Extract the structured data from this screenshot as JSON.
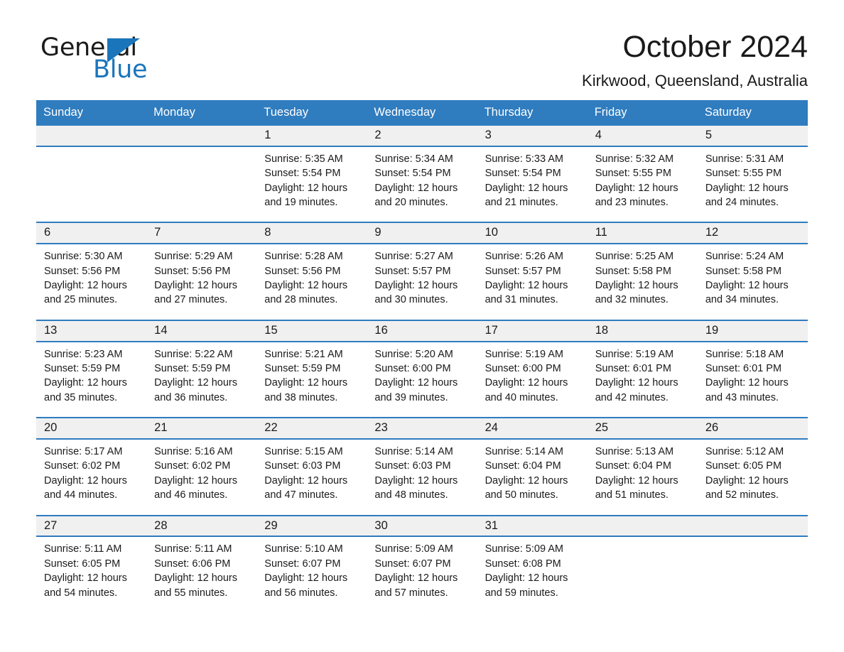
{
  "brand": {
    "name_part1": "General",
    "name_part2": "Blue",
    "logo_icon": "triangle-flag-icon",
    "accent_color": "#1b75bb"
  },
  "header": {
    "month_title": "October 2024",
    "location": "Kirkwood, Queensland, Australia"
  },
  "calendar": {
    "header_bg_color": "#2f7cbf",
    "daynum_bg_color": "#f0f0f0",
    "weekday_headers": [
      "Sunday",
      "Monday",
      "Tuesday",
      "Wednesday",
      "Thursday",
      "Friday",
      "Saturday"
    ],
    "weeks": [
      [
        {
          "day": "",
          "lines": [
            "",
            "",
            "",
            ""
          ]
        },
        {
          "day": "",
          "lines": [
            "",
            "",
            "",
            ""
          ]
        },
        {
          "day": "1",
          "lines": [
            "Sunrise: 5:35 AM",
            "Sunset: 5:54 PM",
            "Daylight: 12 hours",
            "and 19 minutes."
          ]
        },
        {
          "day": "2",
          "lines": [
            "Sunrise: 5:34 AM",
            "Sunset: 5:54 PM",
            "Daylight: 12 hours",
            "and 20 minutes."
          ]
        },
        {
          "day": "3",
          "lines": [
            "Sunrise: 5:33 AM",
            "Sunset: 5:54 PM",
            "Daylight: 12 hours",
            "and 21 minutes."
          ]
        },
        {
          "day": "4",
          "lines": [
            "Sunrise: 5:32 AM",
            "Sunset: 5:55 PM",
            "Daylight: 12 hours",
            "and 23 minutes."
          ]
        },
        {
          "day": "5",
          "lines": [
            "Sunrise: 5:31 AM",
            "Sunset: 5:55 PM",
            "Daylight: 12 hours",
            "and 24 minutes."
          ]
        }
      ],
      [
        {
          "day": "6",
          "lines": [
            "Sunrise: 5:30 AM",
            "Sunset: 5:56 PM",
            "Daylight: 12 hours",
            "and 25 minutes."
          ]
        },
        {
          "day": "7",
          "lines": [
            "Sunrise: 5:29 AM",
            "Sunset: 5:56 PM",
            "Daylight: 12 hours",
            "and 27 minutes."
          ]
        },
        {
          "day": "8",
          "lines": [
            "Sunrise: 5:28 AM",
            "Sunset: 5:56 PM",
            "Daylight: 12 hours",
            "and 28 minutes."
          ]
        },
        {
          "day": "9",
          "lines": [
            "Sunrise: 5:27 AM",
            "Sunset: 5:57 PM",
            "Daylight: 12 hours",
            "and 30 minutes."
          ]
        },
        {
          "day": "10",
          "lines": [
            "Sunrise: 5:26 AM",
            "Sunset: 5:57 PM",
            "Daylight: 12 hours",
            "and 31 minutes."
          ]
        },
        {
          "day": "11",
          "lines": [
            "Sunrise: 5:25 AM",
            "Sunset: 5:58 PM",
            "Daylight: 12 hours",
            "and 32 minutes."
          ]
        },
        {
          "day": "12",
          "lines": [
            "Sunrise: 5:24 AM",
            "Sunset: 5:58 PM",
            "Daylight: 12 hours",
            "and 34 minutes."
          ]
        }
      ],
      [
        {
          "day": "13",
          "lines": [
            "Sunrise: 5:23 AM",
            "Sunset: 5:59 PM",
            "Daylight: 12 hours",
            "and 35 minutes."
          ]
        },
        {
          "day": "14",
          "lines": [
            "Sunrise: 5:22 AM",
            "Sunset: 5:59 PM",
            "Daylight: 12 hours",
            "and 36 minutes."
          ]
        },
        {
          "day": "15",
          "lines": [
            "Sunrise: 5:21 AM",
            "Sunset: 5:59 PM",
            "Daylight: 12 hours",
            "and 38 minutes."
          ]
        },
        {
          "day": "16",
          "lines": [
            "Sunrise: 5:20 AM",
            "Sunset: 6:00 PM",
            "Daylight: 12 hours",
            "and 39 minutes."
          ]
        },
        {
          "day": "17",
          "lines": [
            "Sunrise: 5:19 AM",
            "Sunset: 6:00 PM",
            "Daylight: 12 hours",
            "and 40 minutes."
          ]
        },
        {
          "day": "18",
          "lines": [
            "Sunrise: 5:19 AM",
            "Sunset: 6:01 PM",
            "Daylight: 12 hours",
            "and 42 minutes."
          ]
        },
        {
          "day": "19",
          "lines": [
            "Sunrise: 5:18 AM",
            "Sunset: 6:01 PM",
            "Daylight: 12 hours",
            "and 43 minutes."
          ]
        }
      ],
      [
        {
          "day": "20",
          "lines": [
            "Sunrise: 5:17 AM",
            "Sunset: 6:02 PM",
            "Daylight: 12 hours",
            "and 44 minutes."
          ]
        },
        {
          "day": "21",
          "lines": [
            "Sunrise: 5:16 AM",
            "Sunset: 6:02 PM",
            "Daylight: 12 hours",
            "and 46 minutes."
          ]
        },
        {
          "day": "22",
          "lines": [
            "Sunrise: 5:15 AM",
            "Sunset: 6:03 PM",
            "Daylight: 12 hours",
            "and 47 minutes."
          ]
        },
        {
          "day": "23",
          "lines": [
            "Sunrise: 5:14 AM",
            "Sunset: 6:03 PM",
            "Daylight: 12 hours",
            "and 48 minutes."
          ]
        },
        {
          "day": "24",
          "lines": [
            "Sunrise: 5:14 AM",
            "Sunset: 6:04 PM",
            "Daylight: 12 hours",
            "and 50 minutes."
          ]
        },
        {
          "day": "25",
          "lines": [
            "Sunrise: 5:13 AM",
            "Sunset: 6:04 PM",
            "Daylight: 12 hours",
            "and 51 minutes."
          ]
        },
        {
          "day": "26",
          "lines": [
            "Sunrise: 5:12 AM",
            "Sunset: 6:05 PM",
            "Daylight: 12 hours",
            "and 52 minutes."
          ]
        }
      ],
      [
        {
          "day": "27",
          "lines": [
            "Sunrise: 5:11 AM",
            "Sunset: 6:05 PM",
            "Daylight: 12 hours",
            "and 54 minutes."
          ]
        },
        {
          "day": "28",
          "lines": [
            "Sunrise: 5:11 AM",
            "Sunset: 6:06 PM",
            "Daylight: 12 hours",
            "and 55 minutes."
          ]
        },
        {
          "day": "29",
          "lines": [
            "Sunrise: 5:10 AM",
            "Sunset: 6:07 PM",
            "Daylight: 12 hours",
            "and 56 minutes."
          ]
        },
        {
          "day": "30",
          "lines": [
            "Sunrise: 5:09 AM",
            "Sunset: 6:07 PM",
            "Daylight: 12 hours",
            "and 57 minutes."
          ]
        },
        {
          "day": "31",
          "lines": [
            "Sunrise: 5:09 AM",
            "Sunset: 6:08 PM",
            "Daylight: 12 hours",
            "and 59 minutes."
          ]
        },
        {
          "day": "",
          "lines": [
            "",
            "",
            "",
            ""
          ]
        },
        {
          "day": "",
          "lines": [
            "",
            "",
            "",
            ""
          ]
        }
      ]
    ]
  }
}
